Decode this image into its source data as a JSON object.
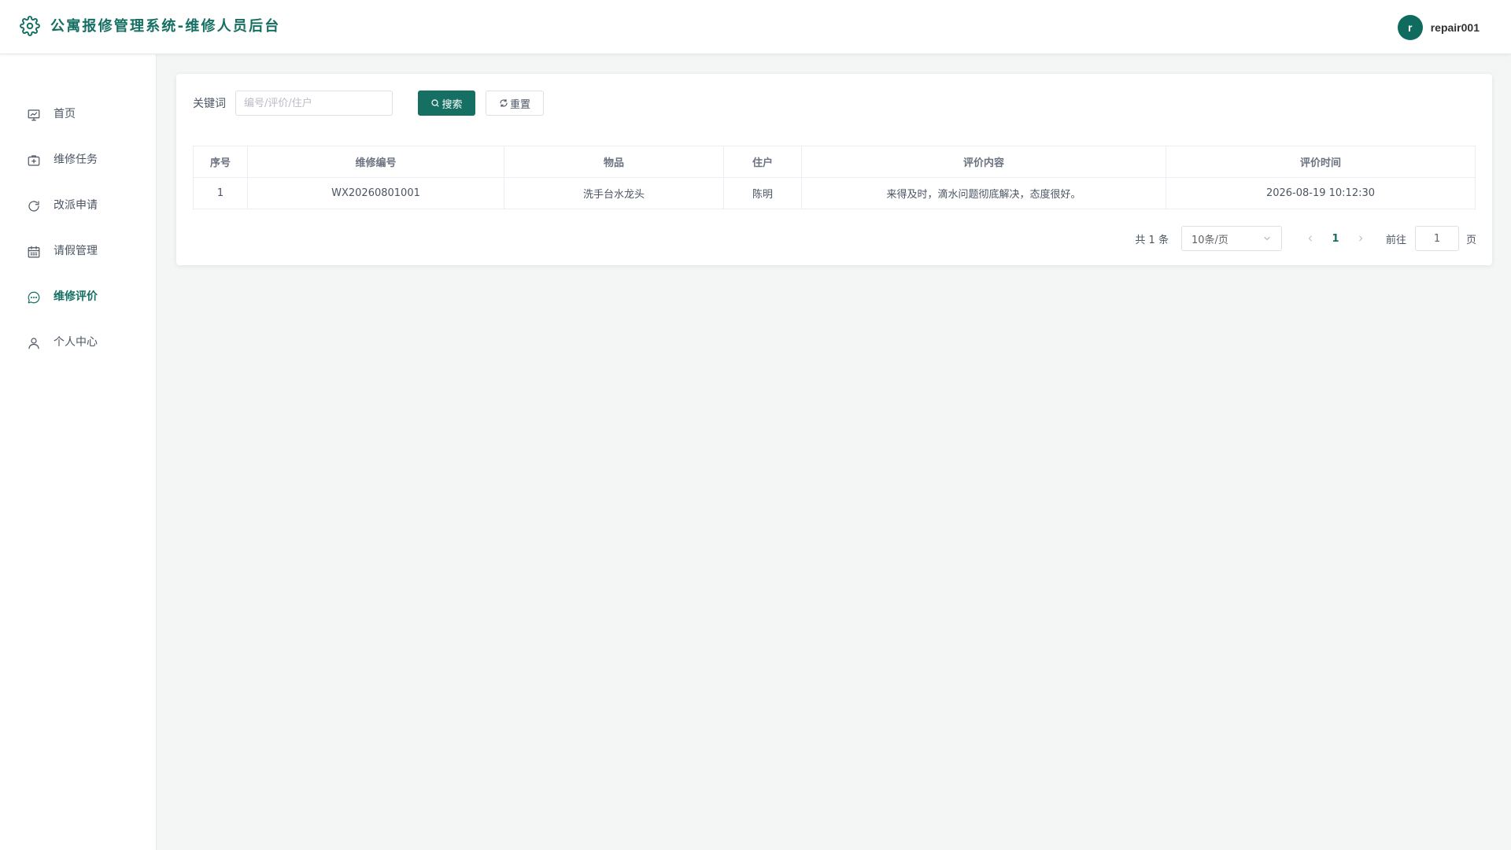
{
  "header": {
    "title": "公寓报修管理系统-维修人员后台",
    "avatar_letter": "r",
    "username": "repair001",
    "accent_color": "#156f62"
  },
  "sidebar": {
    "items": [
      {
        "label": "首页",
        "icon": "dashboard-icon",
        "active": false
      },
      {
        "label": "维修任务",
        "icon": "medical-box-icon",
        "active": false
      },
      {
        "label": "改派申请",
        "icon": "refresh-icon",
        "active": false
      },
      {
        "label": "请假管理",
        "icon": "calendar-icon",
        "active": false
      },
      {
        "label": "维修评价",
        "icon": "chat-bubble-icon",
        "active": true
      },
      {
        "label": "个人中心",
        "icon": "user-icon",
        "active": false
      }
    ]
  },
  "search": {
    "label": "关键词",
    "placeholder": "编号/评价/住户",
    "value": "",
    "search_button": "搜索",
    "reset_button": "重置"
  },
  "table": {
    "columns": [
      "序号",
      "维修编号",
      "物品",
      "住户",
      "评价内容",
      "评价时间"
    ],
    "rows": [
      [
        "1",
        "WX20260801001",
        "洗手台水龙头",
        "陈明",
        "来得及时，滴水问题彻底解决，态度很好。",
        "2026-08-19 10:12:30"
      ]
    ]
  },
  "pagination": {
    "total": "共 1 条",
    "page_size": "10条/页",
    "current_page": "1",
    "goto_label": "前往",
    "goto_value": "1",
    "page_suffix": "页"
  }
}
